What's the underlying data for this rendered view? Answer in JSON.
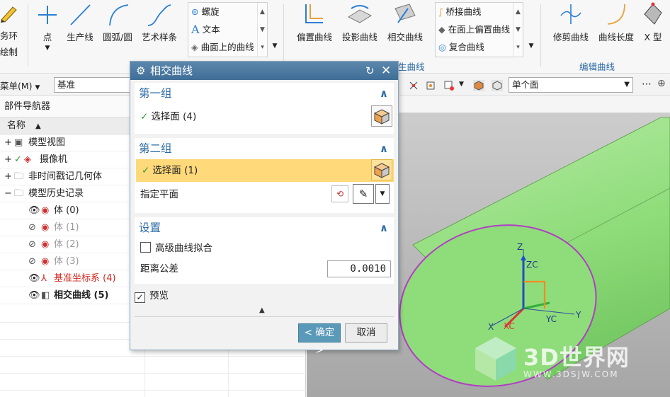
{
  "ribbon": {
    "left_partial_1": "务环",
    "left_partial_2": "绘制",
    "point": "点",
    "line": "生产线",
    "arc": "圆弧/圆",
    "spline": "艺术样条",
    "gallery1": [
      "螺旋",
      "文本",
      "曲面上的曲线"
    ],
    "offset_curve": "偏置曲线",
    "project_curve": "投影曲线",
    "intersect_curve": "相交曲线",
    "gallery2": [
      "桥接曲线",
      "在面上偏置曲线",
      "复合曲线"
    ],
    "trim_curve": "修剪曲线",
    "curve_length": "曲线长度",
    "x_form": "X 型",
    "group_derived_partial": "生曲线",
    "group_edit": "编辑曲线"
  },
  "toolbar": {
    "menu": "菜单(M)",
    "filter_value": "基准",
    "face_rule": "单个面"
  },
  "navigator": {
    "title": "部件导航器",
    "column_name": "名称",
    "items": [
      {
        "label": "模型视图"
      },
      {
        "label": "摄像机"
      },
      {
        "label": "非时间戳记几何体"
      },
      {
        "label": "模型历史记录"
      },
      {
        "label": "体 (0)"
      },
      {
        "label": "体 (1)"
      },
      {
        "label": "体 (2)"
      },
      {
        "label": "体 (3)"
      },
      {
        "label": "基准坐标系 (4)"
      },
      {
        "label": "相交曲线 (5)"
      }
    ]
  },
  "dialog": {
    "title": "相交曲线",
    "group1": {
      "title": "第一组",
      "select_label": "选择面 (4)"
    },
    "group2": {
      "title": "第二组",
      "select_label": "选择面 (1)",
      "plane_label": "指定平面"
    },
    "settings": {
      "title": "设置",
      "advanced_fit": "高级曲线拟合",
      "tolerance_label": "距离公差",
      "tolerance_value": "0.0010"
    },
    "preview": "预览",
    "ok": "< 确定 >",
    "cancel": "取消"
  },
  "viewport": {
    "axis_z": "Z",
    "axis_zc": "ZC",
    "axis_y": "Y",
    "axis_yc": "YC",
    "axis_x": "X",
    "axis_xc": "XC",
    "watermark_title": "3D世界网",
    "watermark_url": "WWW.3DSJW.COM"
  },
  "colors": {
    "accent": "#2b6aa6",
    "titlebar": "#4d7ba2",
    "highlight": "#ffd97a",
    "body_green": "#8fdc7a",
    "ok_button": "#5b99b8"
  }
}
